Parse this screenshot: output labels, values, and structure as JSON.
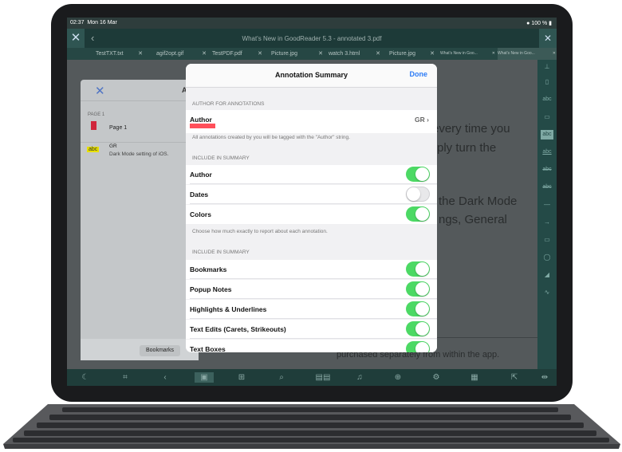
{
  "status": {
    "time": "02:37",
    "date": "Mon 16 Mar",
    "battery": "100 %"
  },
  "titlebar": {
    "title": "What's New in GoodReader 5.3 - annotated 3.pdf"
  },
  "tabs": [
    "TestTXT.txt",
    "agif2opt.gif",
    "TestPDF.pdf",
    "Picture.jpg",
    "watch 3.html",
    "Picture.jpg",
    "What's New in Goo...",
    "What's New in Goo..."
  ],
  "document": {
    "line1": "every time you",
    "line2": "ply turn the",
    "line3": "the Dark Mode",
    "line4": "ngs, General",
    "bottom_line": "purchased separately from within the app."
  },
  "left_panel": {
    "title_initial": "A",
    "page_label": "PAGE 1",
    "row1_label": "Page 1",
    "row2_badge": "abc",
    "row2_author": "GR",
    "row2_text": "Dark Mode setting of iOS.",
    "bookmarks_button": "Bookmarks"
  },
  "modal": {
    "title": "Annotation Summary",
    "done_label": "Done",
    "section_author": "AUTHOR FOR ANNOTATIONS",
    "author_label": "Author",
    "author_value": "GR",
    "author_footer": "All annotations created by you will be tagged with the \"Author\" string.",
    "section_include1": "INCLUDE IN SUMMARY",
    "include_rows": [
      {
        "label": "Author",
        "on": true
      },
      {
        "label": "Dates",
        "on": false
      },
      {
        "label": "Colors",
        "on": true
      }
    ],
    "include_footer": "Choose how much exactly to report about each annotation.",
    "section_include2": "INCLUDE IN SUMMARY",
    "summary_rows": [
      {
        "label": "Bookmarks",
        "on": true
      },
      {
        "label": "Popup Notes",
        "on": true
      },
      {
        "label": "Highlights & Underlines",
        "on": true
      },
      {
        "label": "Text Edits (Carets, Strikeouts)",
        "on": true
      },
      {
        "label": "Text Boxes",
        "on": true
      }
    ]
  },
  "right_toolbar_icons": [
    "pin-icon",
    "book-icon",
    "abc-text-icon",
    "comment-icon",
    "highlight-icon",
    "underline-icon",
    "strikeout-icon",
    "squiggly-icon",
    "line-icon",
    "arrow-icon",
    "rectangle-icon",
    "oval-icon",
    "eraser-icon",
    "freehand-icon"
  ],
  "bottom_toolbar_icons": [
    "night-mode-icon",
    "crop-icon",
    "back-arrow-icon",
    "bookmarks-icon",
    "thumbnails-icon",
    "search-icon",
    "pdf-pages-icon",
    "audio-icon",
    "add-page-icon",
    "settings-icon",
    "file-pages-icon",
    "share-icon",
    "fit-width-icon"
  ],
  "colors": {
    "accent": "#2d7cf6",
    "toggle_on": "#4cd964",
    "toolbar": "#1f3d3a"
  }
}
